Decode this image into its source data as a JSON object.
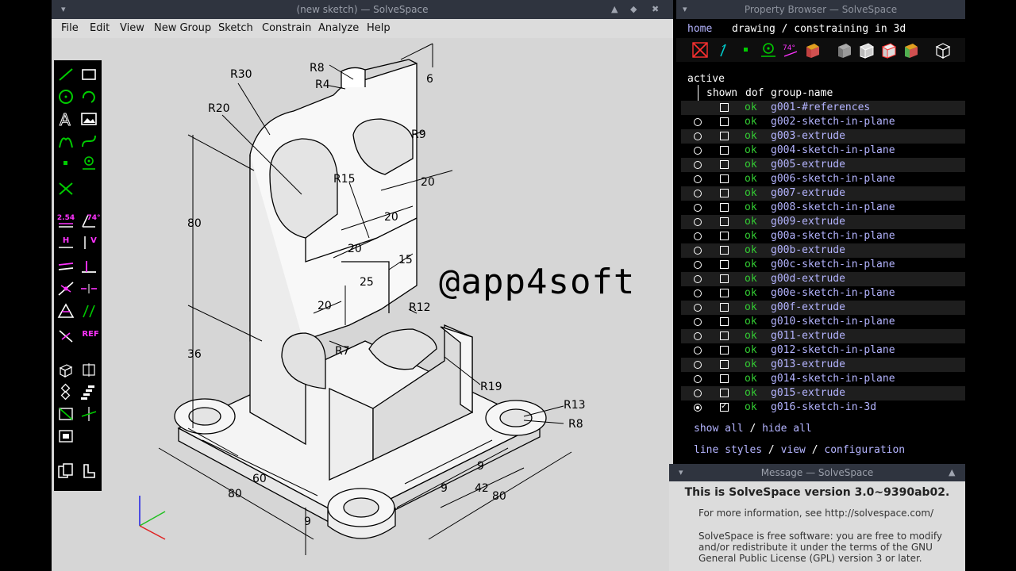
{
  "main_window": {
    "title": "(new sketch) — SolveSpace",
    "menu": [
      "File",
      "Edit",
      "View",
      "New Group",
      "Sketch",
      "Constrain",
      "Analyze",
      "Help"
    ]
  },
  "drawing": {
    "watermark": "@app4soft",
    "dimensions": {
      "r30": "R30",
      "r20": "R20",
      "r8_top": "R8",
      "r4": "R4",
      "d6": "6",
      "r9": "R9",
      "r15": "R15",
      "d20_a": "20",
      "d20_b": "20",
      "d20_c": "20",
      "d80_v": "80",
      "d15": "15",
      "d25": "25",
      "d20_d": "20",
      "r12": "R12",
      "r7": "R7",
      "d36": "36",
      "r19": "R19",
      "r13": "R13",
      "r8_right": "R8",
      "d9_a": "9",
      "d60": "60",
      "d9_b": "9",
      "d42": "42",
      "d80_a": "80",
      "d80_b": "80",
      "d9_c": "9"
    }
  },
  "property_browser": {
    "title": "Property Browser — SolveSpace",
    "nav": {
      "home": "home",
      "context": "drawing / constraining in 3d"
    },
    "header": {
      "active": "active",
      "shown": "shown",
      "dof": "dof",
      "group_name": "group-name"
    },
    "groups": [
      {
        "name": "g001-#references",
        "dof": "ok",
        "active": false,
        "radio": false,
        "shown": false
      },
      {
        "name": "g002-sketch-in-plane",
        "dof": "ok",
        "active": false,
        "radio": true,
        "shown": false
      },
      {
        "name": "g003-extrude",
        "dof": "ok",
        "active": false,
        "radio": true,
        "shown": false
      },
      {
        "name": "g004-sketch-in-plane",
        "dof": "ok",
        "active": false,
        "radio": true,
        "shown": false
      },
      {
        "name": "g005-extrude",
        "dof": "ok",
        "active": false,
        "radio": true,
        "shown": false
      },
      {
        "name": "g006-sketch-in-plane",
        "dof": "ok",
        "active": false,
        "radio": true,
        "shown": false
      },
      {
        "name": "g007-extrude",
        "dof": "ok",
        "active": false,
        "radio": true,
        "shown": false
      },
      {
        "name": "g008-sketch-in-plane",
        "dof": "ok",
        "active": false,
        "radio": true,
        "shown": false
      },
      {
        "name": "g009-extrude",
        "dof": "ok",
        "active": false,
        "radio": true,
        "shown": false
      },
      {
        "name": "g00a-sketch-in-plane",
        "dof": "ok",
        "active": false,
        "radio": true,
        "shown": false
      },
      {
        "name": "g00b-extrude",
        "dof": "ok",
        "active": false,
        "radio": true,
        "shown": false
      },
      {
        "name": "g00c-sketch-in-plane",
        "dof": "ok",
        "active": false,
        "radio": true,
        "shown": false
      },
      {
        "name": "g00d-extrude",
        "dof": "ok",
        "active": false,
        "radio": true,
        "shown": false
      },
      {
        "name": "g00e-sketch-in-plane",
        "dof": "ok",
        "active": false,
        "radio": true,
        "shown": false
      },
      {
        "name": "g00f-extrude",
        "dof": "ok",
        "active": false,
        "radio": true,
        "shown": false
      },
      {
        "name": "g010-sketch-in-plane",
        "dof": "ok",
        "active": false,
        "radio": true,
        "shown": false
      },
      {
        "name": "g011-extrude",
        "dof": "ok",
        "active": false,
        "radio": true,
        "shown": false
      },
      {
        "name": "g012-sketch-in-plane",
        "dof": "ok",
        "active": false,
        "radio": true,
        "shown": false
      },
      {
        "name": "g013-extrude",
        "dof": "ok",
        "active": false,
        "radio": true,
        "shown": false
      },
      {
        "name": "g014-sketch-in-plane",
        "dof": "ok",
        "active": false,
        "radio": true,
        "shown": false
      },
      {
        "name": "g015-extrude",
        "dof": "ok",
        "active": false,
        "radio": true,
        "shown": false
      },
      {
        "name": "g016-sketch-in-3d",
        "dof": "ok",
        "active": true,
        "radio": true,
        "shown": true
      }
    ],
    "show_all": "show all",
    "hide_all": "hide all",
    "line_styles": "line styles",
    "view": "view",
    "configuration": "configuration",
    "sep": "/"
  },
  "message_window": {
    "title": "Message — SolveSpace",
    "heading": "This is SolveSpace version 3.0~9390ab02.",
    "info": "For more information, see http://solvespace.com/",
    "license_1": "SolveSpace is free software: you are free to modify",
    "license_2": "and/or redistribute it under the terms of the GNU",
    "license_3": "General Public License (GPL) version 3 or later."
  },
  "colors": {
    "titlebar": "#2f343f",
    "canvas": "#d6d6d6",
    "link": "#b4b4ff",
    "ok_green": "#33cc33",
    "tool_green": "#00cc00",
    "tool_magenta": "#ff33ff"
  }
}
